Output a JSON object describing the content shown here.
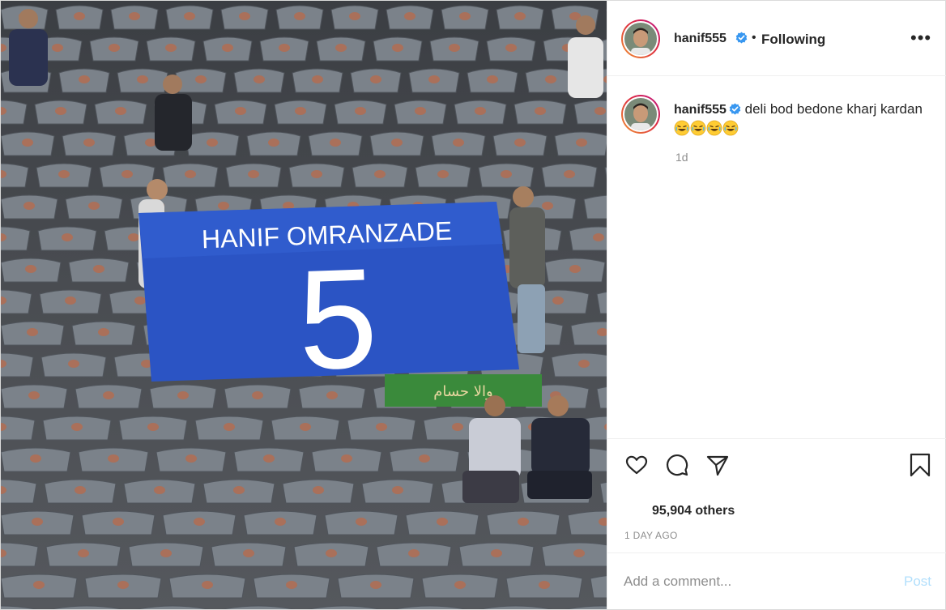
{
  "photo": {
    "banner_name": "HANIF OMRANZADE",
    "banner_number": "5",
    "banner_color": "#2b54c4",
    "green_banner_text": "والا حسام"
  },
  "post": {
    "username": "hanif555",
    "separator": "•",
    "follow_status": "Following",
    "more_label": "•••",
    "caption_username": "hanif555",
    "caption_text": " deli bod bedone kharj kardan",
    "caption_emoji_count": 4,
    "time_ago": "1d",
    "likes": "95,904 others",
    "date": "1 DAY AGO",
    "comment_placeholder": "Add a comment...",
    "post_label": "Post"
  },
  "icons": {
    "like": "heart-icon",
    "comment": "comment-icon",
    "share": "share-icon",
    "save": "bookmark-icon",
    "verified": "verified-badge-icon",
    "more": "more-options-icon"
  },
  "colors": {
    "verified": "#3897f0",
    "post_button": "#b2dffc",
    "secondary_text": "#8e8e8e"
  }
}
